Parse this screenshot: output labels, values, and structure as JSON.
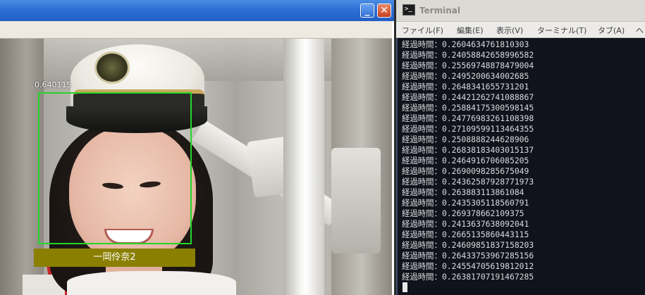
{
  "image_window": {
    "minimize_glyph": "_",
    "close_glyph": "✕",
    "detection": {
      "score": "0.640115",
      "label": "一岡伶奈2"
    }
  },
  "terminal": {
    "title": "Terminal",
    "icon_glyph": ">_",
    "menu": [
      "ファイル(F)",
      "編集(E)",
      "表示(V)",
      "ターミナル(T)",
      "タブ(A)",
      "ヘ"
    ],
    "lines": [
      "経過時間：0.2604634761810303",
      "経過時間：0.24058842658996582",
      "経過時間：0.25569748878479004",
      "経過時間：0.2495200634002685",
      "経過時間：0.2648341655731201",
      "経過時間：0.24421262741088867",
      "経過時間：0.25884175300598145",
      "経過時間：0.24776983261108398",
      "経過時間：0.27109599113464355",
      "経過時間：0.2508888244628906",
      "経過時間：0.26838183403015137",
      "経過時間：0.2464916706085205",
      "経過時間：0.2690098285675049",
      "経過時間：0.24362587928771973",
      "経過時間：0.263883113861084",
      "経過時間：0.2435305118560791",
      "経過時間：0.269378662109375",
      "経過時間：0.2413637638092041",
      "経過時間：0.2665135860443115",
      "経過時間：0.24609851837158203",
      "経過時間：0.26433753967285156",
      "経過時間：0.24554705619812012",
      "経過時間：0.26381707191467285"
    ]
  }
}
